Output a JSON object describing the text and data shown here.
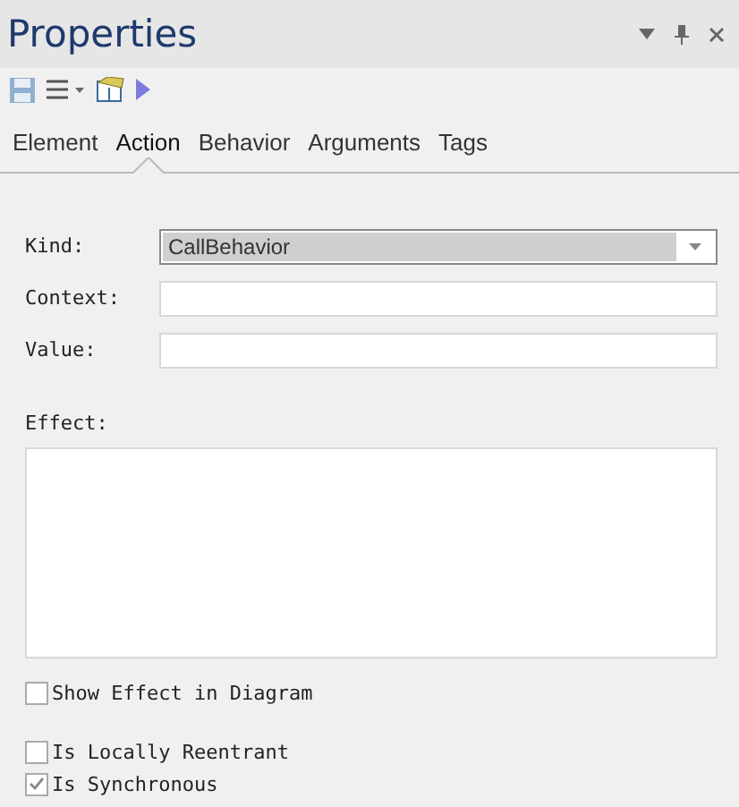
{
  "window": {
    "title": "Properties"
  },
  "tabs": [
    {
      "label": "Element",
      "selected": false
    },
    {
      "label": "Action",
      "selected": true
    },
    {
      "label": "Behavior",
      "selected": false
    },
    {
      "label": "Arguments",
      "selected": false
    },
    {
      "label": "Tags",
      "selected": false
    }
  ],
  "fields": [
    {
      "label": "Kind:",
      "kind": "dropdown",
      "value": "CallBehavior"
    },
    {
      "label": "Context:",
      "kind": "text"
    },
    {
      "label": "Value:",
      "kind": "text"
    }
  ],
  "effect": {
    "label": "Effect:"
  },
  "checkbox_groups": [
    {
      "items": [
        {
          "label": "Show Effect in Diagram",
          "checked": false
        }
      ]
    },
    {
      "items": [
        {
          "label": "Is Locally Reentrant",
          "checked": false
        },
        {
          "label": "Is Synchronous",
          "checked": true
        }
      ]
    }
  ]
}
